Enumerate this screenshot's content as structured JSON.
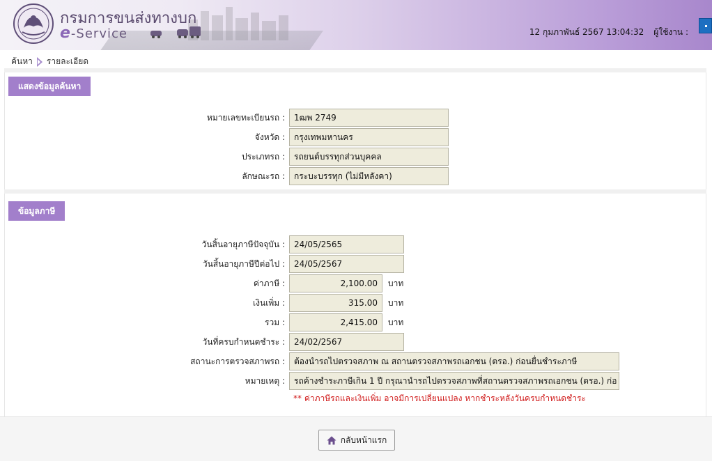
{
  "header": {
    "brand_thai": "กรมการขนส่งทางบก",
    "brand_e": "e",
    "brand_service": "-Service",
    "datetime": "12 กุมภาพันธ์ 2567 13:04:32",
    "user_label": "ผู้ใช้งาน :"
  },
  "breadcrumb": {
    "search": "ค้นหา",
    "detail": "รายละเอียด"
  },
  "search_section": {
    "title": "แสดงข้อมูลค้นหา",
    "fields": [
      {
        "label": "หมายเลขทะเบียนรถ :",
        "value": "1ฒพ 2749"
      },
      {
        "label": "จังหวัด :",
        "value": "กรุงเทพมหานคร"
      },
      {
        "label": "ประเภทรถ :",
        "value": "รถยนต์บรรทุกส่วนบุคคล"
      },
      {
        "label": "ลักษณะรถ :",
        "value": "กระบะบรรทุก (ไม่มีหลังคา)"
      }
    ]
  },
  "tax_section": {
    "title": "ข้อมูลภาษี",
    "current_expiry": {
      "label": "วันสิ้นอายุภาษีปัจจุบัน :",
      "value": "24/05/2565"
    },
    "next_expiry": {
      "label": "วันสิ้นอายุภาษีปีต่อไป :",
      "value": "24/05/2567"
    },
    "tax": {
      "label": "ค่าภาษี :",
      "value": "2,100.00",
      "unit": "บาท"
    },
    "surcharge": {
      "label": "เงินเพิ่ม :",
      "value": "315.00",
      "unit": "บาท"
    },
    "total": {
      "label": "รวม :",
      "value": "2,415.00",
      "unit": "บาท"
    },
    "due_date": {
      "label": "วันที่ครบกำหนดชำระ :",
      "value": "24/02/2567"
    },
    "inspection": {
      "label": "สถานะการตรวจสภาพรถ :",
      "value": "ต้องนำรถไปตรวจสภาพ ณ สถานตรวจสภาพรถเอกชน (ตรอ.) ก่อนยื่นชำระภาษี"
    },
    "remark": {
      "label": "หมายเหตุ :",
      "value": "รถค้างชำระภาษีเกิน 1 ปี กรุณานำรถไปตรวจสภาพที่สถานตรวจสภาพรถเอกชน (ตรอ.) ก่อ"
    },
    "note": "** ค่าภาษีรถและเงินเพิ่ม อาจมีการเปลี่ยนแปลง หากชำระหลังวันครบกำหนดชำระ"
  },
  "actions": {
    "home_label": "กลับหน้าแรก"
  },
  "colors": {
    "section_head": "#a27fcb",
    "field_bg": "#eeecdc",
    "note": "#d01919"
  }
}
